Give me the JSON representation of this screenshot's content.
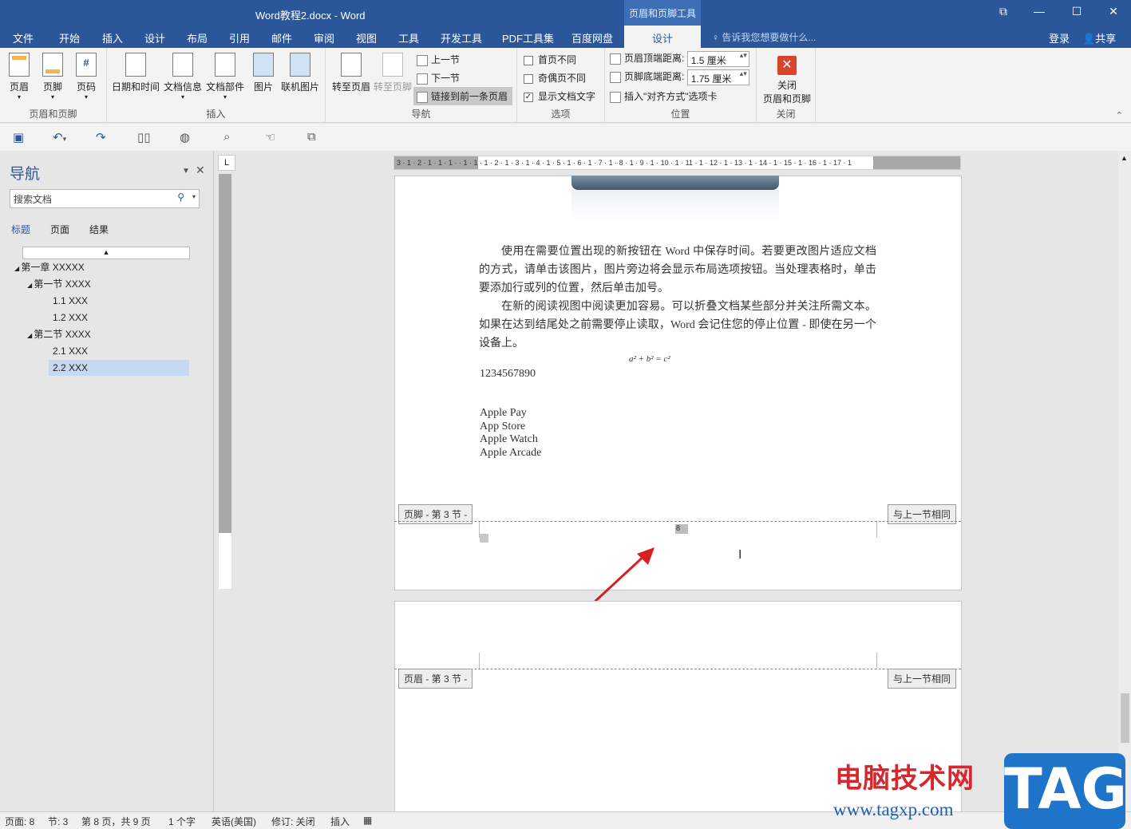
{
  "window": {
    "title": "Word教程2.docx - Word",
    "context_tab": "页眉和页脚工具"
  },
  "tabs": [
    "文件",
    "开始",
    "插入",
    "设计",
    "布局",
    "引用",
    "邮件",
    "审阅",
    "视图",
    "工具",
    "开发工具",
    "PDF工具集",
    "百度网盘"
  ],
  "active_tab": "设计",
  "tell_me": "告诉我您想要做什么...",
  "login": "登录",
  "share": "共享",
  "ribbon": {
    "hf": {
      "name": "页眉和页脚",
      "header": "页眉",
      "footer": "页脚",
      "page_no": "页码"
    },
    "insert": {
      "name": "插入",
      "datetime": "日期和时间",
      "docinfo": "文档信息",
      "parts": "文档部件",
      "picture": "图片",
      "online_picture": "联机图片"
    },
    "nav": {
      "name": "导航",
      "goto_header": "转至页眉",
      "goto_footer": "转至页脚",
      "prev": "上一节",
      "next": "下一节",
      "link_prev": "链接到前一条页眉"
    },
    "options": {
      "name": "选项",
      "diff_first": "首页不同",
      "diff_odd_even": "奇偶页不同",
      "show_text": "显示文档文字"
    },
    "position": {
      "name": "位置",
      "header_top_label": "页眉顶端距离:",
      "header_top": "1.5 厘米",
      "footer_bottom_label": "页脚底端距离:",
      "footer_bottom": "1.75 厘米",
      "align_tab": "插入\"对齐方式\"选项卡"
    },
    "close": {
      "name": "关闭",
      "label1": "关闭",
      "label2": "页眉和页脚"
    }
  },
  "navigation": {
    "title": "导航",
    "search_placeholder": "搜索文档",
    "tabs": [
      "标题",
      "页面",
      "结果"
    ],
    "tree": [
      "第一章 XXXXX",
      "第一节 XXXX",
      "1.1 XXX",
      "1.2 XXX",
      "第二节 XXXX",
      "2.1 XXX",
      "2.2 XXX"
    ],
    "selected": "2.2 XXX"
  },
  "ruler": {
    "text": "3 · 1 · 2 · 1 · 1 · 1 ·   · 1 · 1 · 1 · 2 · 1 · 3 · 1 · 4 · 1 · 5 · 1 · 6 · 1 · 7 · 1 · 8 · 1 · 9 · 1 · 10 · 1 · 11 · 1 · 12 · 1 · 13 · 1 · 14 · 1 · 15 · 1 · 16 · 1 · 17 · 1"
  },
  "document": {
    "para1": "使用在需要位置出现的新按钮在 Word 中保存时间。若要更改图片适应文档的方式，请单击该图片，图片旁边将会显示布局选项按钮。当处理表格时，单击要添加行或列的位置，然后单击加号。",
    "para2": "在新的阅读视图中阅读更加容易。可以折叠文档某些部分并关注所需文本。如果在达到结尾处之前需要停止读取，Word 会记住您的停止位置 - 即使在另一个设备上。",
    "equation": "a² + b² = c²",
    "number": "1234567890",
    "list": [
      "Apple Pay",
      "App Store",
      "Apple Watch",
      "Apple Arcade"
    ],
    "footer_label": "页脚 - 第 3 节 -",
    "same_as_prev": "与上一节相同",
    "page_num": "8",
    "header_label": "页眉 - 第 3 节 -"
  },
  "status": {
    "page": "页面: 8",
    "section": "节: 3",
    "pages": "第 8 页，共 9 页",
    "words": "1 个字",
    "lang": "英语(美国)",
    "track": "修订: 关闭",
    "insert": "插入"
  },
  "watermark": {
    "cn": "电脑技术网",
    "url": "www.tagxp.com",
    "tag": "TAG"
  }
}
